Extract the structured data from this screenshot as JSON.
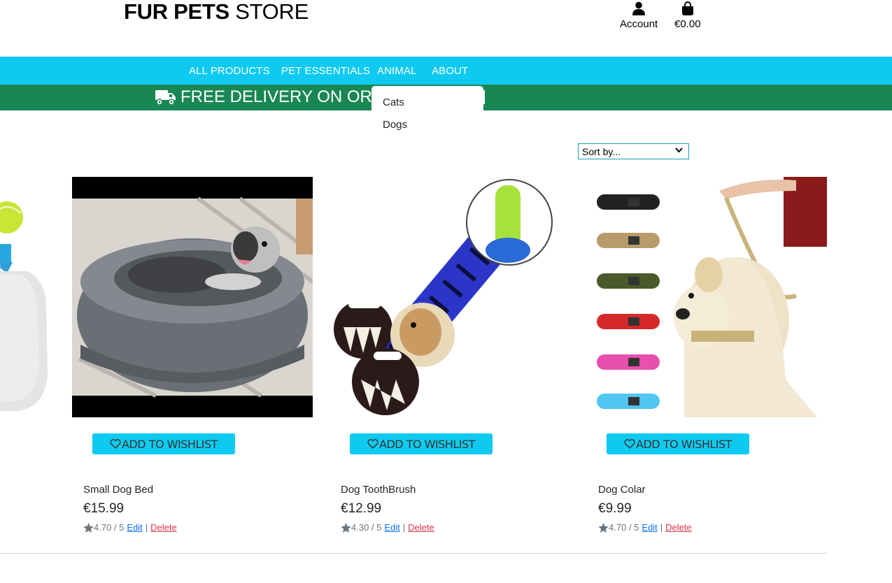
{
  "header": {
    "brand_bold": "FUR PETS",
    "brand_light": "STORE",
    "account_label": "Account",
    "cart_total": "€0.00",
    "account_icon": "user-icon",
    "cart_icon": "shopping-bag-icon"
  },
  "nav": {
    "items": [
      "ALL PRODUCTS",
      "PET ESSENTIALS",
      "ANIMAL",
      "ABOUT"
    ],
    "dropdown": [
      "Cats",
      "Dogs"
    ]
  },
  "banner": {
    "text": "FREE DELIVERY ON ORD",
    "icon": "truck-icon"
  },
  "sort": {
    "selected": "Sort by..."
  },
  "products": [
    {
      "name": "Small Dog Bed",
      "price": "€15.99",
      "rating": "4.70 / 5",
      "wishlist": "ADD TO WISHLIST",
      "edit": "Edit",
      "delete": "Delete"
    },
    {
      "name": "Dog ToothBrush",
      "price": "€12.99",
      "rating": "4.30 / 5",
      "wishlist": "ADD TO WISHLIST",
      "edit": "Edit",
      "delete": "Delete"
    },
    {
      "name": "Dog Colar",
      "price": "€9.99",
      "rating": "4.70 / 5",
      "wishlist": "ADD TO WISHLIST",
      "edit": "Edit",
      "delete": "Delete"
    }
  ],
  "colors": {
    "nav": "#0ecaf0",
    "banner": "#198754",
    "edit_link": "#0d6efd",
    "delete_link": "#dc3545"
  }
}
